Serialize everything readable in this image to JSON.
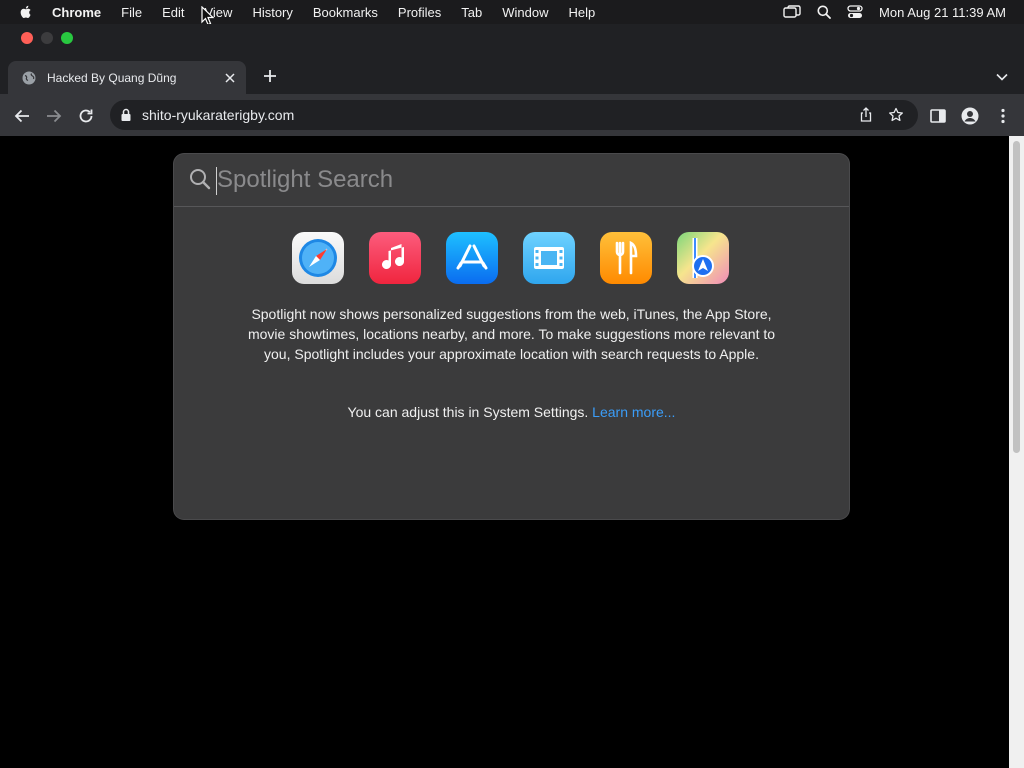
{
  "menubar": {
    "items": [
      "Chrome",
      "File",
      "Edit",
      "View",
      "History",
      "Bookmarks",
      "Profiles",
      "Tab",
      "Window",
      "Help"
    ],
    "clock": "Mon Aug 21  11:39 AM",
    "icons": [
      "apple-icon",
      "window-mirroring-icon",
      "search-icon",
      "control-center-icon"
    ]
  },
  "browser": {
    "tab_title": "Hacked By Quang Dũng",
    "url": "shito-ryukaraterigby.com"
  },
  "spotlight": {
    "placeholder": "Spotlight Search",
    "apps": [
      "safari-icon",
      "music-icon",
      "app-store-icon",
      "movies-icon",
      "restaurants-icon",
      "maps-icon"
    ],
    "message": "Spotlight now shows personalized suggestions from the web, iTunes, the App Store, movie showtimes, locations nearby, and more. To make suggestions more relevant to you, Spotlight includes your approximate location with search requests to Apple.",
    "adjust_text": "You can adjust this in System Settings.",
    "learn_more": "Learn more..."
  },
  "colors": {
    "accent_link": "#3b9df8",
    "panel_bg": "#3b3b3c",
    "close_button": "#ff5f57",
    "zoom_button": "#28c840"
  }
}
